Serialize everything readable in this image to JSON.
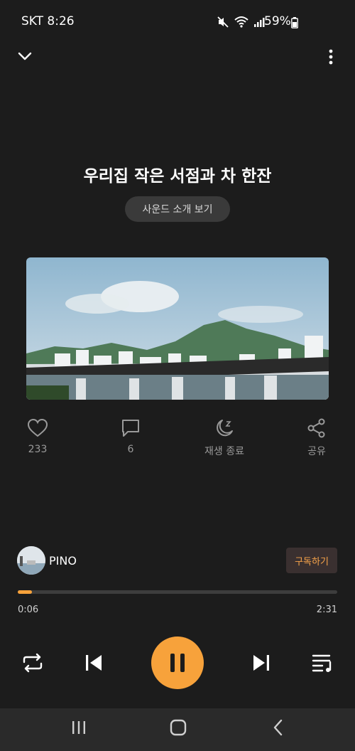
{
  "status_bar": {
    "carrier_time": "SKT 8:26",
    "battery": "59%",
    "icons": [
      "mute-icon",
      "wifi-icon",
      "signal-icon",
      "battery-icon"
    ]
  },
  "header": {
    "collapse_icon": "chevron-down-icon",
    "more_icon": "more-vertical-icon"
  },
  "track": {
    "title": "우리집 작은 서점과 차 한잔",
    "sound_intro_label": "사운드 소개 보기"
  },
  "actions": [
    {
      "icon": "heart-icon",
      "label": "233"
    },
    {
      "icon": "comment-icon",
      "label": "6"
    },
    {
      "icon": "sleep-timer-icon",
      "label": "재생 종료"
    },
    {
      "icon": "share-icon",
      "label": "공유"
    }
  ],
  "creator": {
    "name": "PINO",
    "subscribe_label": "구독하기"
  },
  "player": {
    "progress": 0.045,
    "current_time": "0:06",
    "total_time": "2:31",
    "accent": "#f7a23b"
  },
  "controls": [
    "repeat-icon",
    "previous-icon",
    "pause-icon",
    "next-icon",
    "playlist-icon"
  ],
  "nav": [
    "recent-apps-icon",
    "home-icon",
    "back-icon"
  ]
}
